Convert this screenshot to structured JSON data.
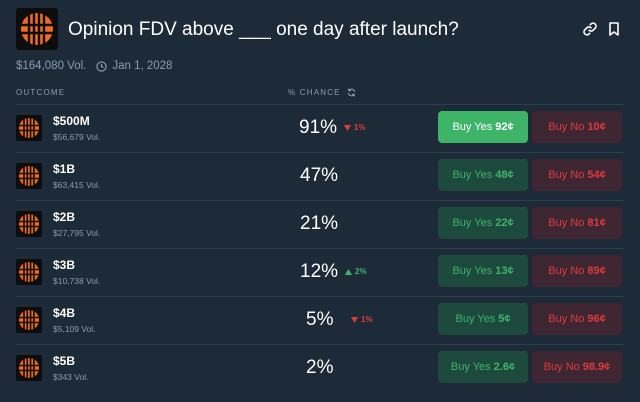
{
  "header": {
    "title": "Opinion FDV above ___ one day after launch?"
  },
  "meta": {
    "volume": "$164,080 Vol.",
    "date": "Jan 1, 2028"
  },
  "columns": {
    "outcome": "OUTCOME",
    "chance": "% CHANCE"
  },
  "rows": [
    {
      "name": "$500M",
      "vol": "$56,679 Vol.",
      "pct": "91%",
      "change": "1%",
      "dir": "down",
      "yes_label": "Buy Yes",
      "yes_price": "92¢",
      "no_label": "Buy No",
      "no_price": "10¢"
    },
    {
      "name": "$1B",
      "vol": "$63,415 Vol.",
      "pct": "47%",
      "change": "",
      "dir": "",
      "yes_label": "Buy Yes",
      "yes_price": "48¢",
      "no_label": "Buy No",
      "no_price": "54¢"
    },
    {
      "name": "$2B",
      "vol": "$27,795 Vol.",
      "pct": "21%",
      "change": "",
      "dir": "",
      "yes_label": "Buy Yes",
      "yes_price": "22¢",
      "no_label": "Buy No",
      "no_price": "81¢"
    },
    {
      "name": "$3B",
      "vol": "$10,738 Vol.",
      "pct": "12%",
      "change": "2%",
      "dir": "up",
      "yes_label": "Buy Yes",
      "yes_price": "13¢",
      "no_label": "Buy No",
      "no_price": "89¢"
    },
    {
      "name": "$4B",
      "vol": "$5,109 Vol.",
      "pct": "5%",
      "change": "1%",
      "dir": "down",
      "yes_label": "Buy Yes",
      "yes_price": "5¢",
      "no_label": "Buy No",
      "no_price": "96¢"
    },
    {
      "name": "$5B",
      "vol": "$343 Vol.",
      "pct": "2%",
      "change": "",
      "dir": "",
      "yes_label": "Buy Yes",
      "yes_price": "2.6¢",
      "no_label": "Buy No",
      "no_price": "98.9¢"
    }
  ],
  "icons": {
    "logo": "opinion-logo",
    "link": "link-icon",
    "bookmark": "bookmark-icon",
    "calendar": "clock-icon",
    "refresh": "refresh-icon"
  },
  "colors": {
    "background": "#1d2b39",
    "yes": "#3db468",
    "no": "#e23939",
    "muted": "#899cb2",
    "logo": "#f26b1d"
  }
}
